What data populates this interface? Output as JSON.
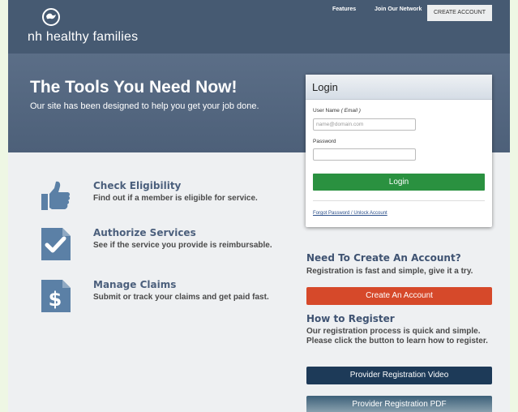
{
  "brand": {
    "name": "nh healthy families"
  },
  "nav": {
    "features": "Features",
    "join": "Join Our Network",
    "create_account": "CREATE ACCOUNT"
  },
  "hero": {
    "title": "The Tools You Need Now!",
    "subtitle": "Our site has been designed to help you get your job done."
  },
  "features": [
    {
      "icon": "thumbs-up-icon",
      "title": "Check Eligibility",
      "desc": "Find out if a member is eligible for service."
    },
    {
      "icon": "checklist-icon",
      "title": "Authorize Services",
      "desc": "See if the service you provide is reimbursable."
    },
    {
      "icon": "dollar-document-icon",
      "title": "Manage Claims",
      "desc": "Submit or track your claims and get paid fast."
    }
  ],
  "login": {
    "title": "Login",
    "username_label": "User Name",
    "username_hint": "( Email )",
    "username_placeholder": "name@domain.com",
    "password_label": "Password",
    "password_value": "",
    "button": "Login",
    "forgot_link": "Forgot Password / Unlock Account"
  },
  "create_account_section": {
    "title": "Need To Create An Account?",
    "text": "Registration is fast and simple, give it a try.",
    "button": "Create An Account"
  },
  "register_section": {
    "title": "How to Register",
    "text": "Our registration process is quick and simple. Please click the button to learn how to register.",
    "video_button": "Provider Registration Video",
    "pdf_button": "Provider Registration PDF"
  },
  "colors": {
    "header": "#465a72",
    "login_green": "#2a9140",
    "create_red": "#d6492a",
    "video_navy": "#1d3a58",
    "icon_blue": "#5b80a6"
  }
}
